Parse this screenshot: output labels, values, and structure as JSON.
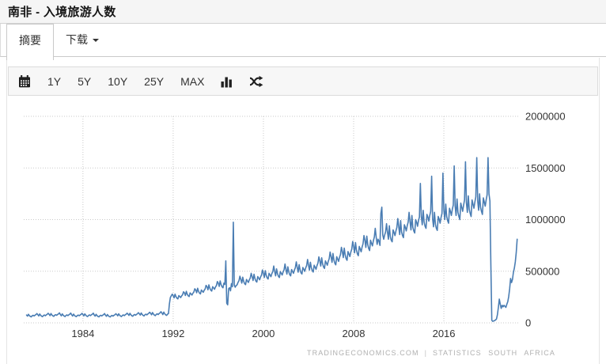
{
  "page": {
    "title": "南非 - 入境旅游人数",
    "tabs": [
      {
        "label": "摘要",
        "active": true
      },
      {
        "label": "下载",
        "has_dropdown": true
      }
    ],
    "toolbar": {
      "calendar_icon": "calendar-icon",
      "range_buttons": [
        "1Y",
        "5Y",
        "10Y",
        "25Y",
        "MAX"
      ],
      "column_chart_icon": "column-chart-icon",
      "shuffle_icon": "shuffle-icon"
    },
    "attribution": {
      "left": "TRADINGECONOMICS.COM",
      "separator": "|",
      "right": "STATISTICS SOUTH AFRICA"
    }
  },
  "colors": {
    "line": "#4a7db3",
    "grid": "#c9c9c9",
    "axis_text": "#333333",
    "titlebar_bg": "#f5f5f5",
    "toolbar_bg": "#f7f7f7",
    "attribution_text": "#b0b0b0"
  },
  "chart_data": {
    "type": "line",
    "title": "南非 - 入境旅游人数",
    "xlabel": "",
    "ylabel": "",
    "grid": "dotted",
    "legend": "none",
    "y_axis_position": "right",
    "ylim": [
      0,
      2000000
    ],
    "y_ticks": [
      0,
      500000,
      1000000,
      1500000,
      2000000
    ],
    "y_tick_labels": [
      "0",
      "500000",
      "1000000",
      "1500000",
      "2000000"
    ],
    "x_ticks": [
      1984,
      1992,
      2000,
      2008,
      2016
    ],
    "x_tick_labels": [
      "1984",
      "1992",
      "2000",
      "2008",
      "2016"
    ],
    "xlim_years": [
      1978.75,
      2022.8
    ],
    "series": [
      {
        "name": "入境旅游人数",
        "color": "#4a7db3",
        "frequency": "monthly",
        "start_year": 1979,
        "start_month": 1,
        "values": [
          76000,
          65000,
          83000,
          70000,
          62000,
          58000,
          69000,
          73000,
          67000,
          74000,
          80000,
          90000,
          79000,
          67000,
          86000,
          73000,
          65000,
          60000,
          71000,
          76000,
          69000,
          77000,
          83000,
          93000,
          82000,
          70000,
          90000,
          76000,
          68000,
          63000,
          75000,
          79000,
          73000,
          81000,
          87000,
          97000,
          80000,
          68000,
          87000,
          74000,
          66000,
          61000,
          72000,
          77000,
          70000,
          78000,
          84000,
          95000,
          78000,
          66000,
          85000,
          72000,
          64000,
          60000,
          71000,
          75000,
          69000,
          76000,
          82000,
          92000,
          80000,
          68000,
          87000,
          74000,
          65000,
          61000,
          72000,
          77000,
          70000,
          78000,
          84000,
          94000,
          76000,
          65000,
          83000,
          70000,
          62000,
          58000,
          69000,
          73000,
          67000,
          74000,
          80000,
          90000,
          74000,
          63000,
          81000,
          69000,
          61000,
          57000,
          67000,
          72000,
          65000,
          73000,
          78000,
          88000,
          80000,
          68000,
          88000,
          74000,
          66000,
          61000,
          72000,
          77000,
          70000,
          78000,
          84000,
          94000,
          84000,
          72000,
          92000,
          78000,
          69000,
          64000,
          76000,
          81000,
          74000,
          82000,
          88000,
          99000,
          88000,
          75000,
          96000,
          81000,
          72000,
          67000,
          79000,
          84000,
          77000,
          86000,
          92000,
          103000,
          92000,
          78000,
          100000,
          85000,
          75000,
          70000,
          82000,
          88000,
          80000,
          90000,
          96000,
          108000,
          96000,
          80000,
          104000,
          88000,
          78000,
          72000,
          84000,
          90000,
          185000,
          245000,
          262000,
          278000,
          264000,
          242000,
          278000,
          253000,
          239000,
          232000,
          264000,
          255000,
          245000,
          261000,
          272000,
          301000,
          290000,
          265000,
          305000,
          277000,
          262000,
          255000,
          290000,
          280000,
          269000,
          287000,
          299000,
          330000,
          318000,
          291000,
          335000,
          305000,
          288000,
          280000,
          318000,
          307000,
          296000,
          315000,
          328000,
          363000,
          350000,
          320000,
          368000,
          335000,
          317000,
          308000,
          350000,
          338000,
          325000,
          347000,
          361000,
          400000,
          385000,
          353000,
          406000,
          369000,
          349000,
          340000,
          385000,
          372000,
          600000,
          190000,
          175000,
          330000,
          340000,
          310000,
          380000,
          350000,
          975000,
          365000,
          345000,
          362000,
          368000,
          392000,
          408000,
          452000,
          420000,
          385000,
          442000,
          402000,
          380000,
          370000,
          420000,
          406000,
          391000,
          417000,
          434000,
          480000,
          448000,
          410000,
          471000,
          429000,
          405000,
          395000,
          448000,
          433000,
          417000,
          445000,
          463000,
          512000,
          480000,
          440000,
          505000,
          460000,
          435000,
          424000,
          480000,
          464000,
          447000,
          477000,
          497000,
          550000,
          497000,
          455000,
          523000,
          476000,
          450000,
          439000,
          497000,
          480000,
          463000,
          494000,
          515000,
          570000,
          516000,
          472000,
          543000,
          494000,
          467000,
          455000,
          516000,
          498000,
          480000,
          512000,
          534000,
          591000,
          536000,
          491000,
          564000,
          513000,
          485000,
          473000,
          536000,
          518000,
          499000,
          532000,
          555000,
          614000,
          558000,
          511000,
          587000,
          534000,
          505000,
          492000,
          558000,
          539000,
          519000,
          554000,
          578000,
          639000,
          600000,
          550000,
          630000,
          572000,
          541000,
          527000,
          600000,
          580000,
          558000,
          596000,
          621000,
          686000,
          640000,
          586000,
          672000,
          610000,
          577000,
          562000,
          640000,
          618000,
          595000,
          635000,
          662000,
          731000,
          690000,
          632000,
          724000,
          658000,
          622000,
          606000,
          690000,
          667000,
          642000,
          685000,
          714000,
          788000,
          740000,
          678000,
          777000,
          705000,
          667000,
          650000,
          740000,
          715000,
          688000,
          734000,
          766000,
          845000,
          800000,
          730000,
          840000,
          760000,
          720000,
          700000,
          800000,
          770000,
          745000,
          795000,
          830000,
          915000,
          830000,
          760000,
          810000,
          790000,
          750000,
          1060000,
          1120000,
          850000,
          810000,
          850000,
          880000,
          960000,
          880000,
          810000,
          940000,
          835000,
          800000,
          785000,
          900000,
          875000,
          845000,
          890000,
          925000,
          1010000,
          930000,
          855000,
          990000,
          880000,
          845000,
          825000,
          950000,
          925000,
          890000,
          940000,
          975000,
          1070000,
          980000,
          900000,
          1040000,
          925000,
          890000,
          870000,
          1000000,
          975000,
          935000,
          990000,
          1025000,
          1350000,
          1030000,
          950000,
          1090000,
          975000,
          935000,
          915000,
          1050000,
          1025000,
          985000,
          1040000,
          1080000,
          1420000,
          1010000,
          930000,
          1070000,
          955000,
          915000,
          895000,
          1030000,
          1005000,
          965000,
          1020000,
          1060000,
          1450000,
          1090000,
          1000000,
          1150000,
          1030000,
          990000,
          965000,
          1110000,
          1080000,
          1040000,
          1100000,
          1140000,
          1520000,
          1130000,
          1040000,
          1200000,
          1070000,
          1030000,
          1000000,
          1160000,
          1120000,
          1080000,
          1140000,
          1190000,
          1560000,
          1160000,
          1070000,
          1230000,
          1100000,
          1060000,
          1030000,
          1190000,
          1150000,
          1110000,
          1170000,
          1220000,
          1600000,
          1180000,
          1090000,
          1250000,
          1120000,
          1080000,
          1050000,
          1210000,
          1170000,
          1130000,
          1190000,
          1240000,
          1600000,
          1250000,
          1180000,
          560000,
          25000,
          15000,
          18000,
          22000,
          28000,
          38000,
          80000,
          150000,
          230000,
          180000,
          140000,
          170000,
          155000,
          170000,
          160000,
          150000,
          180000,
          205000,
          255000,
          330000,
          430000,
          390000,
          420000,
          490000,
          530000,
          590000,
          680000,
          810000
        ]
      }
    ]
  }
}
